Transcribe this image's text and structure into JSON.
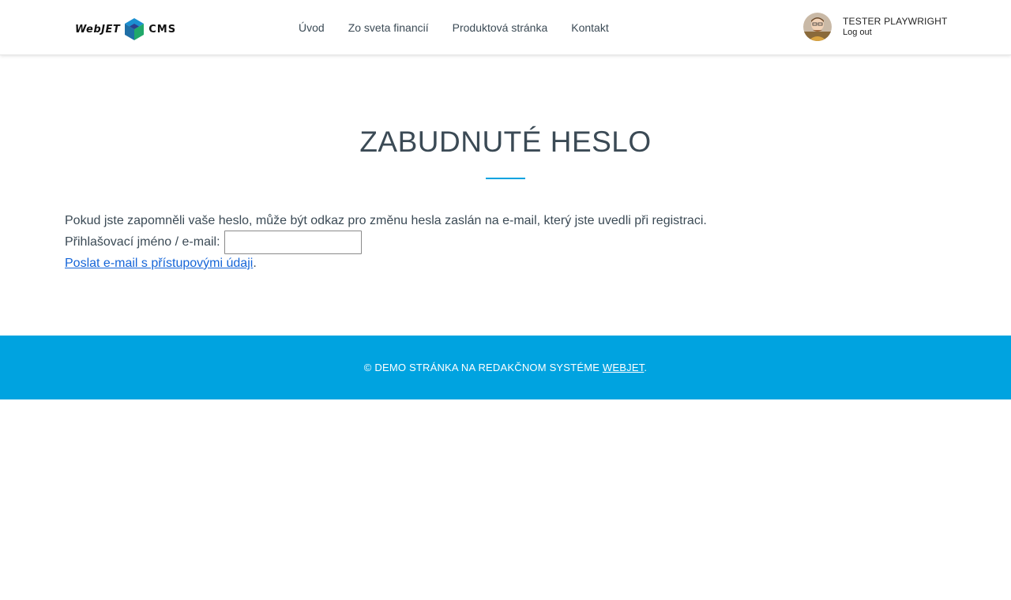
{
  "header": {
    "logo": {
      "word_left": "WebJET",
      "word_right": "CMS",
      "icon": "webjet-cube-icon"
    },
    "nav": {
      "items": [
        {
          "label": "Úvod"
        },
        {
          "label": "Zo sveta financií"
        },
        {
          "label": "Produktová stránka"
        },
        {
          "label": "Kontakt"
        }
      ]
    },
    "user": {
      "name": "TESTER PLAYWRIGHT",
      "logout": "Log out",
      "avatar_icon": "user-avatar"
    }
  },
  "main": {
    "title": "ZABUDNUTÉ HESLO",
    "intro": "Pokud jste zapomněli vaše heslo, může být odkaz pro změnu hesla zaslán na e-mail, který jste uvedli při registraci.",
    "login_label": "Přihlašovací jméno / e-mail:",
    "login_value": "",
    "send_link": "Poslat e-mail s přístupovými údaji",
    "send_suffix": "."
  },
  "footer": {
    "text": "© DEMO STRÁNKA NA REDAKČNOM SYSTÉME ",
    "link": "WEBJET",
    "suffix": "."
  },
  "colors": {
    "accent": "#00a3e0",
    "text": "#3b4a55",
    "link": "#1565d8"
  }
}
